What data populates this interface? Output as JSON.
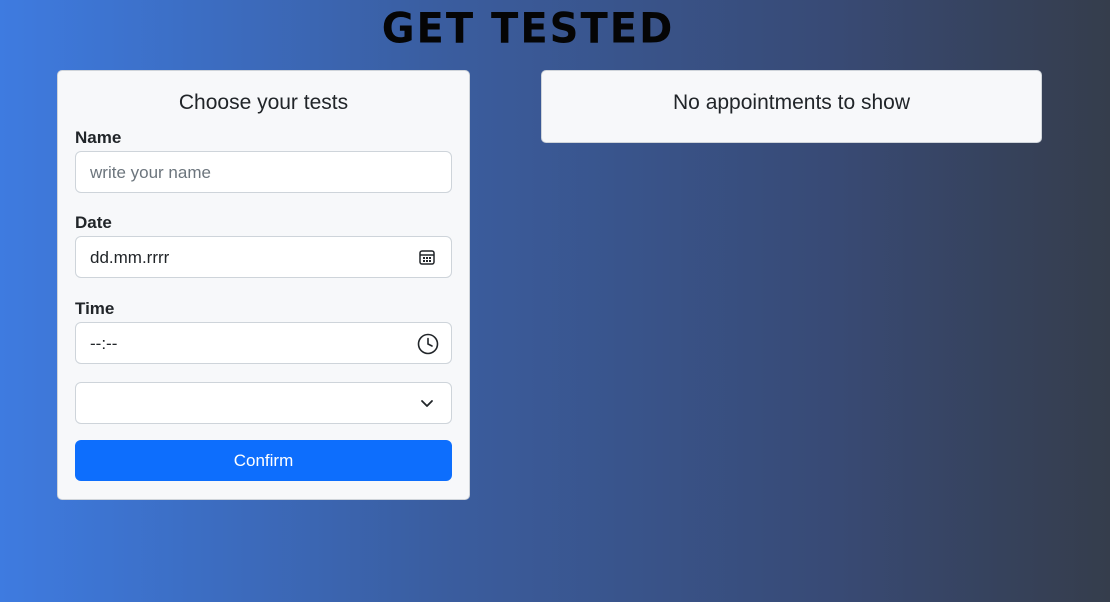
{
  "header": {
    "title": "GET TESTED"
  },
  "form": {
    "heading": "Choose your tests",
    "name_label": "Name",
    "name_placeholder": "write your name",
    "date_label": "Date",
    "date_value": "dd.mm.rrrr",
    "time_label": "Time",
    "time_value": "--:--",
    "select_value": "",
    "confirm_label": "Confirm",
    "icons": {
      "date": "calendar-icon",
      "time": "clock-icon",
      "select": "chevron-down-icon"
    },
    "colors": {
      "button": "#0d6efd"
    }
  },
  "appointments": {
    "empty_message": "No appointments to show"
  }
}
